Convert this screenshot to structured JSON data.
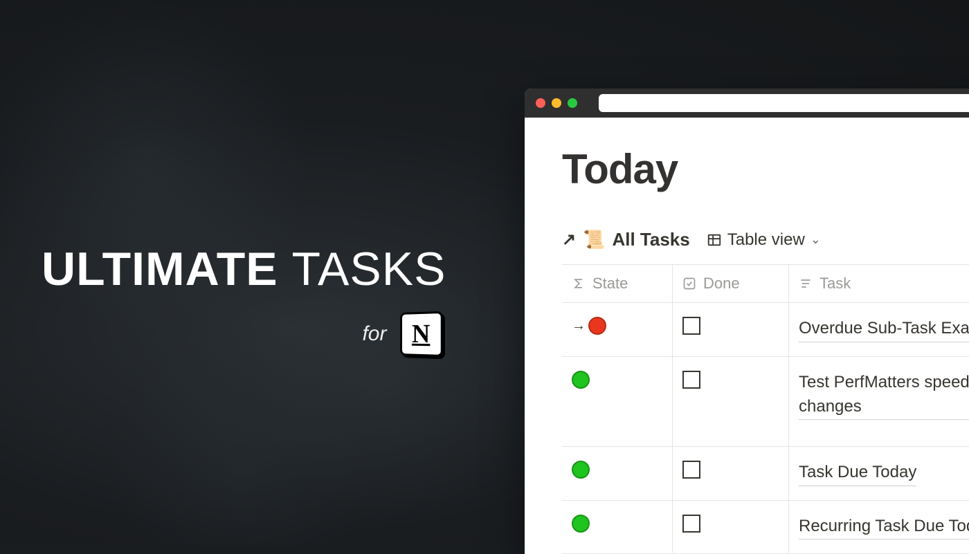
{
  "hero": {
    "word_bold": "ULTIMATE",
    "word_thin": "TASKS",
    "for_label": "for",
    "notion_glyph": "N"
  },
  "page": {
    "title": "Today"
  },
  "database": {
    "link_label": "All Tasks",
    "scroll_icon": "📜",
    "view_label": "Table view"
  },
  "columns": {
    "state": "State",
    "done": "Done",
    "task": "Task"
  },
  "rows": [
    {
      "state_color": "red",
      "has_sub_arrow": true,
      "done": false,
      "task": "Overdue Sub-Task Exam"
    },
    {
      "state_color": "green",
      "has_sub_arrow": false,
      "done": false,
      "task": "Test PerfMatters speed changes"
    },
    {
      "state_color": "green",
      "has_sub_arrow": false,
      "done": false,
      "task": "Task Due Today"
    },
    {
      "state_color": "green",
      "has_sub_arrow": false,
      "done": false,
      "task": "Recurring Task Due Toda"
    }
  ]
}
